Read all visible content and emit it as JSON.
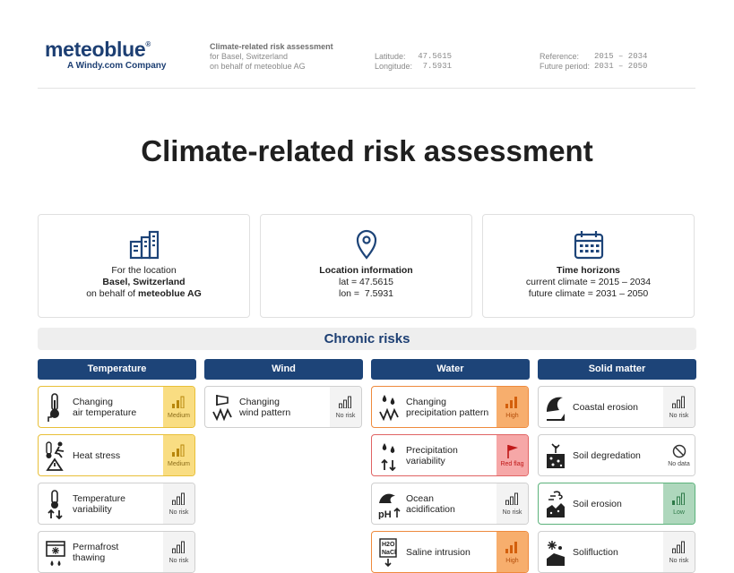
{
  "header": {
    "logo_text": "meteoblue",
    "logo_registered": "®",
    "logo_subtitle": "A Windy.com Company",
    "doc_title": "Climate-related risk assessment",
    "doc_location_line": "for Basel, Switzerland",
    "doc_behalf_line": "on behalf of meteoblue AG",
    "latitude_label": "Latitude:",
    "latitude_value": "47.5615",
    "longitude_label": "Longitude:",
    "longitude_value": "7.5931",
    "reference_label": "Reference:",
    "reference_value": "2015 – 2034",
    "future_label": "Future period:",
    "future_value": "2031 – 2050"
  },
  "main_title": "Climate-related risk assessment",
  "cards": {
    "location": {
      "icon": "buildings-icon",
      "line1": "For the location",
      "line2": "Basel, Switzerland",
      "line3_prefix": "on behalf of ",
      "line3_bold": "meteoblue AG"
    },
    "info": {
      "icon": "map-pin-icon",
      "title": "Location information",
      "lat": "lat = 47.5615",
      "lon": "lon =  7.5931"
    },
    "time": {
      "icon": "calendar-icon",
      "title": "Time horizons",
      "current": "current climate = 2015 – 2034",
      "future": "future climate = 2031 – 2050"
    }
  },
  "section_title": "Chronic risks",
  "columns": {
    "temperature": "Temperature",
    "wind": "Wind",
    "water": "Water",
    "solid": "Solid matter"
  },
  "risks": {
    "changing_air_temperature": {
      "label": "Changing\nair temperature",
      "level": "Medium",
      "icon": "thermometer-icon"
    },
    "heat_stress": {
      "label": "Heat stress",
      "level": "Medium",
      "icon": "heat-stress-icon"
    },
    "temperature_variability": {
      "label": "Temperature\nvariability",
      "level": "No risk",
      "icon": "thermometer-variability-icon"
    },
    "permafrost_thawing": {
      "label": "Permafrost\nthawing",
      "level": "No risk",
      "icon": "permafrost-icon"
    },
    "changing_wind_pattern": {
      "label": "Changing\nwind pattern",
      "level": "No risk",
      "icon": "wind-icon"
    },
    "changing_precipitation_pattern": {
      "label": "Changing\nprecipitation pattern",
      "level": "High",
      "icon": "precipitation-icon"
    },
    "precipitation_variability": {
      "label": "Precipitation\nvariability",
      "level": "Red flag",
      "icon": "precipitation-variability-icon"
    },
    "ocean_acidification": {
      "label": "Ocean\nacidification",
      "level": "No risk",
      "icon": "ocean-ph-icon"
    },
    "saline_intrusion": {
      "label": "Saline intrusion",
      "level": "High",
      "icon": "saline-icon"
    },
    "coastal_erosion": {
      "label": "Coastal erosion",
      "level": "No risk",
      "icon": "coastal-wave-icon"
    },
    "soil_degredation": {
      "label": "Soil degredation",
      "level": "No data",
      "icon": "soil-degradation-icon"
    },
    "soil_erosion": {
      "label": "Soil erosion",
      "level": "Low",
      "icon": "soil-erosion-icon"
    },
    "solifluction": {
      "label": "Solifluction",
      "level": "No risk",
      "icon": "solifluction-icon"
    }
  },
  "colors": {
    "brand_blue": "#1d4478",
    "medium": "#f9dd82",
    "high": "#f7ae6d",
    "red_flag": "#f6a7a7",
    "low": "#aed7bc",
    "none": "#f3f3f3"
  }
}
